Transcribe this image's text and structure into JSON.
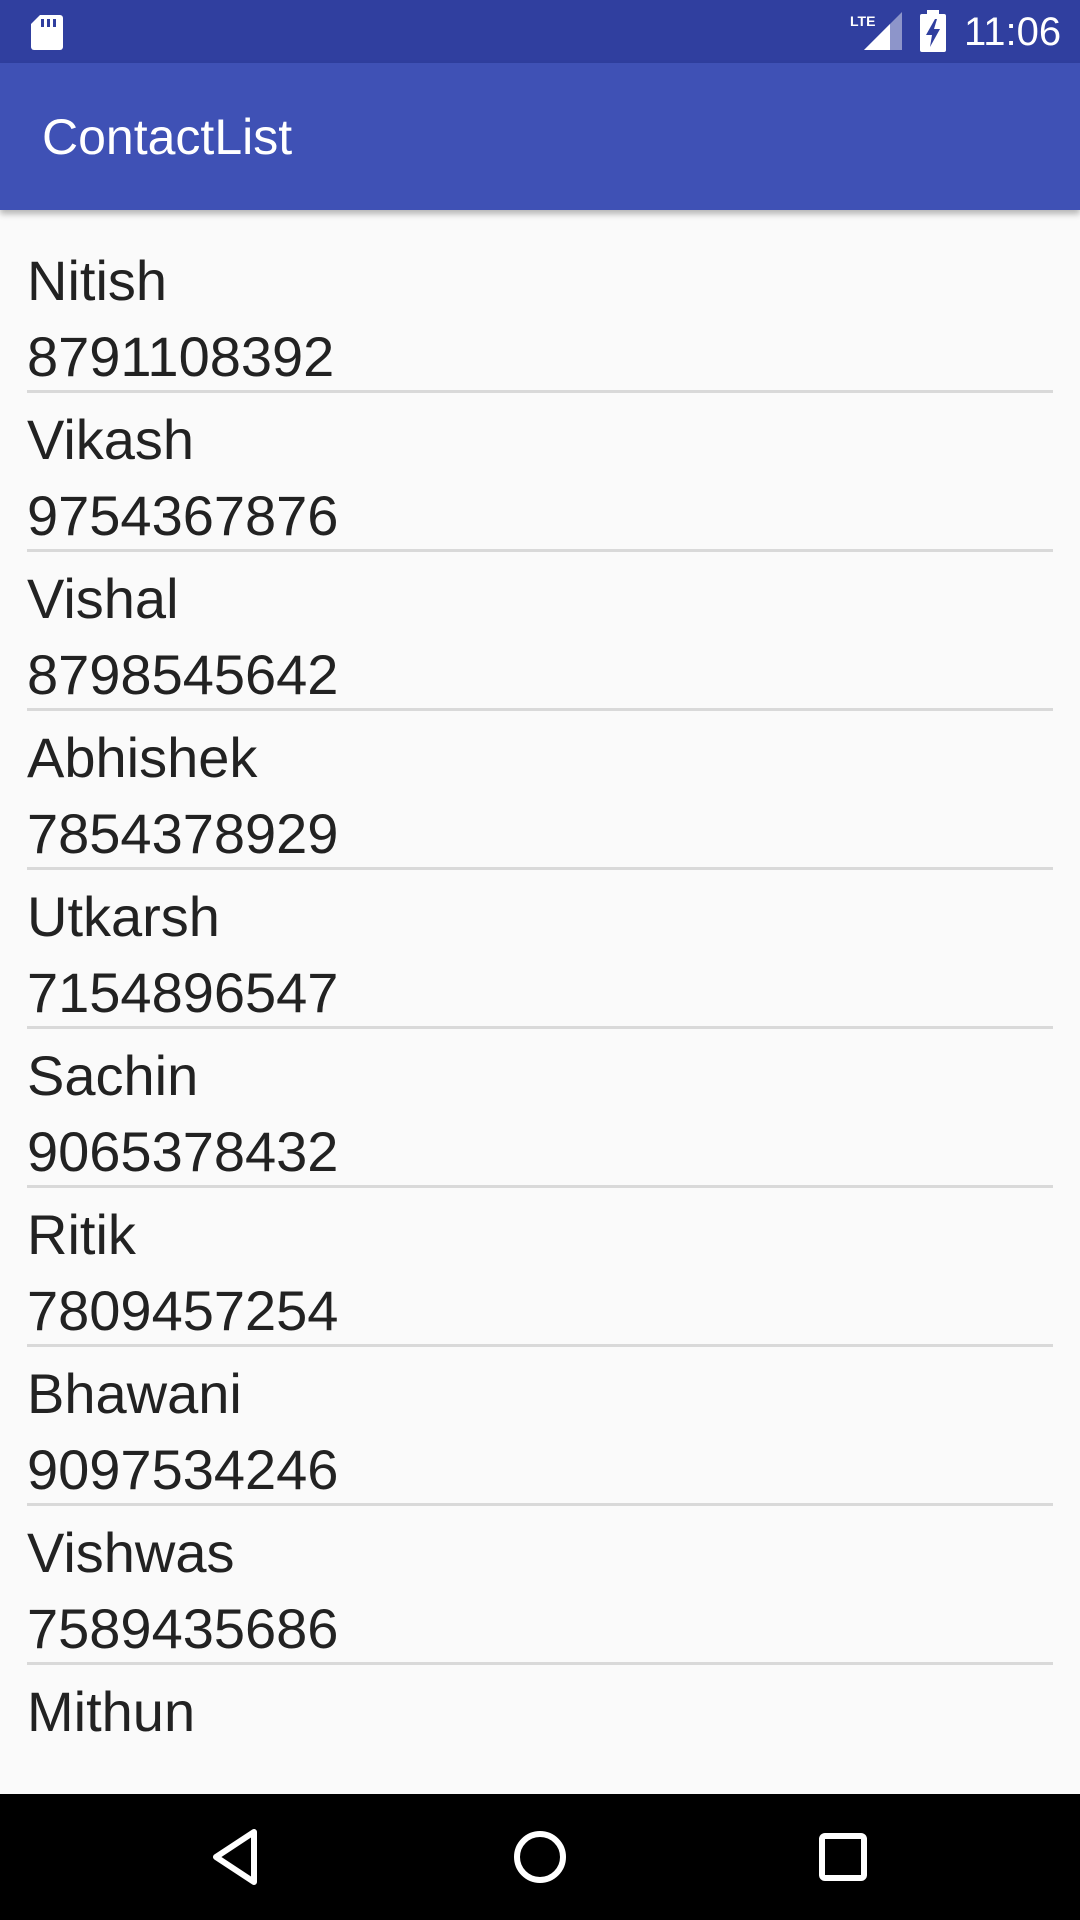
{
  "status_bar": {
    "time": "11:06",
    "network_label": "LTE",
    "icons": [
      "sd-card-icon",
      "lte-signal-icon",
      "battery-charging-icon"
    ],
    "background_color": "#303f9f"
  },
  "app_bar": {
    "title": "ContactList",
    "background_color": "#3f51b5"
  },
  "contacts": [
    {
      "name": "Nitish",
      "phone": "8791108392"
    },
    {
      "name": "Vikash",
      "phone": "9754367876"
    },
    {
      "name": "Vishal",
      "phone": "8798545642"
    },
    {
      "name": "Abhishek",
      "phone": "7854378929"
    },
    {
      "name": "Utkarsh",
      "phone": "7154896547"
    },
    {
      "name": "Sachin",
      "phone": "9065378432"
    },
    {
      "name": "Ritik",
      "phone": "7809457254"
    },
    {
      "name": "Bhawani",
      "phone": "9097534246"
    },
    {
      "name": "Vishwas",
      "phone": "7589435686"
    },
    {
      "name": "Mithun",
      "phone": ""
    }
  ],
  "nav_bar": {
    "icons": [
      "back-icon",
      "home-icon",
      "recents-icon"
    ]
  }
}
